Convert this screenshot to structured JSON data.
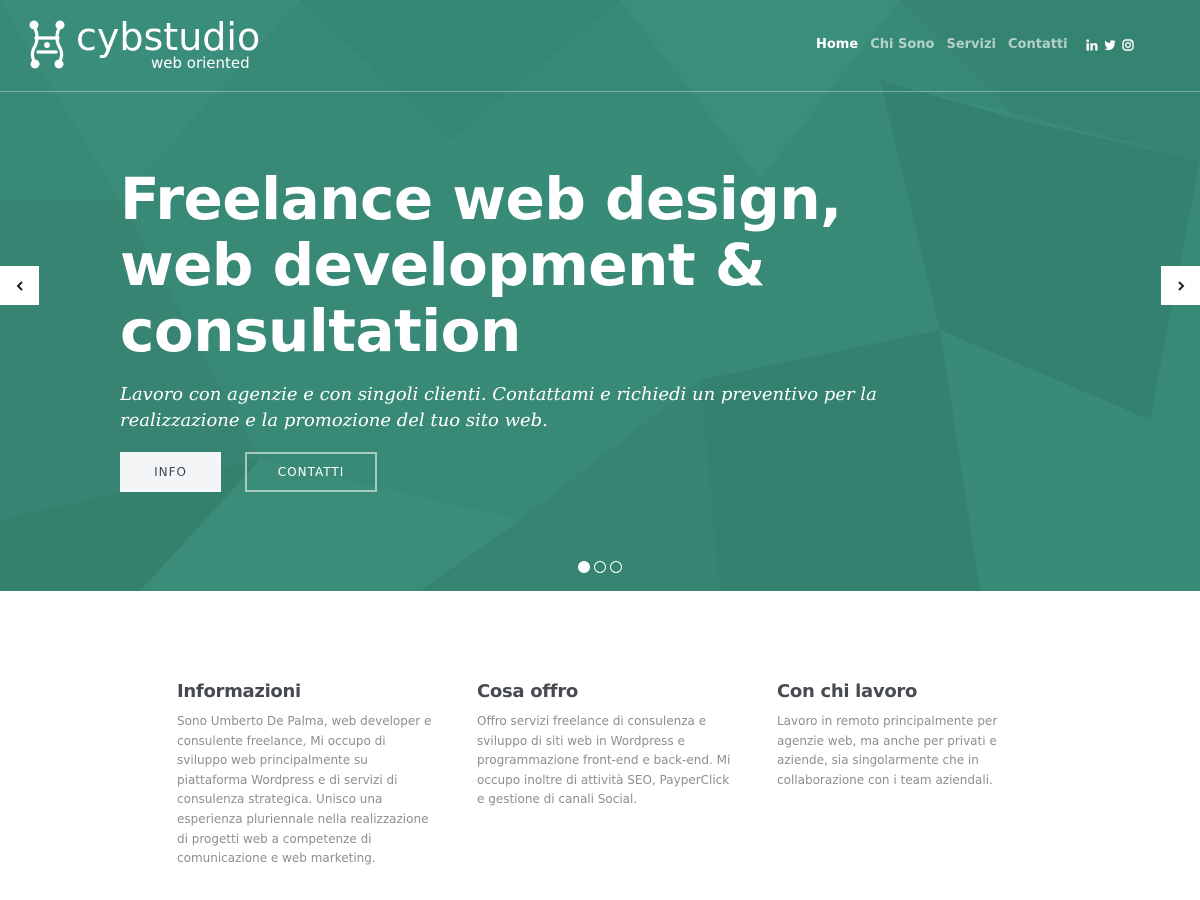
{
  "colors": {
    "hero_bg": "#388a77",
    "button_light_bg": "#f4f5f7",
    "heading_text": "#474b4f",
    "body_text": "#8b8f93"
  },
  "brand": {
    "name": "cybstudio",
    "tagline": "web oriented",
    "logo_icon": "molecule-icon"
  },
  "nav": {
    "items": [
      {
        "label": "Home",
        "active": true
      },
      {
        "label": "Chi Sono",
        "active": false
      },
      {
        "label": "Servizi",
        "active": false
      },
      {
        "label": "Contatti",
        "active": false
      }
    ],
    "social": [
      {
        "icon": "linkedin-icon"
      },
      {
        "icon": "twitter-icon"
      },
      {
        "icon": "instagram-icon"
      }
    ]
  },
  "hero": {
    "title_lines": [
      "Freelance web design,",
      "web development &",
      "consultation"
    ],
    "subtitle": "Lavoro con agenzie e con singoli clienti. Contattami e richiedi un preventivo per la realizzazione e la promozione del tuo sito web.",
    "buttons": {
      "info": "INFO",
      "contatti": "CONTATTI"
    },
    "slider": {
      "prev_icon": "chevron-left-icon",
      "next_icon": "chevron-right-icon",
      "slide_count": 3,
      "active_slide": 1
    }
  },
  "features": [
    {
      "title": "Informazioni",
      "text": "Sono Umberto De Palma, web developer e consulente freelance, Mi occupo di sviluppo web principalmente su piattaforma Wordpress e di servizi di consulenza strategica. Unisco una esperienza pluriennale nella realizzazione di progetti web a competenze di comunicazione e web marketing."
    },
    {
      "title": "Cosa offro",
      "text": "Offro servizi freelance di consulenza e sviluppo di siti web in Wordpress e programmazione front-end e back-end. Mi occupo inoltre di attività SEO, PayperClick e gestione di canali Social."
    },
    {
      "title": "Con chi lavoro",
      "text": "Lavoro in remoto principalmente per agenzie web, ma anche per privati e aziende, sia singolarmente che in collaborazione con i team aziendali."
    }
  ]
}
